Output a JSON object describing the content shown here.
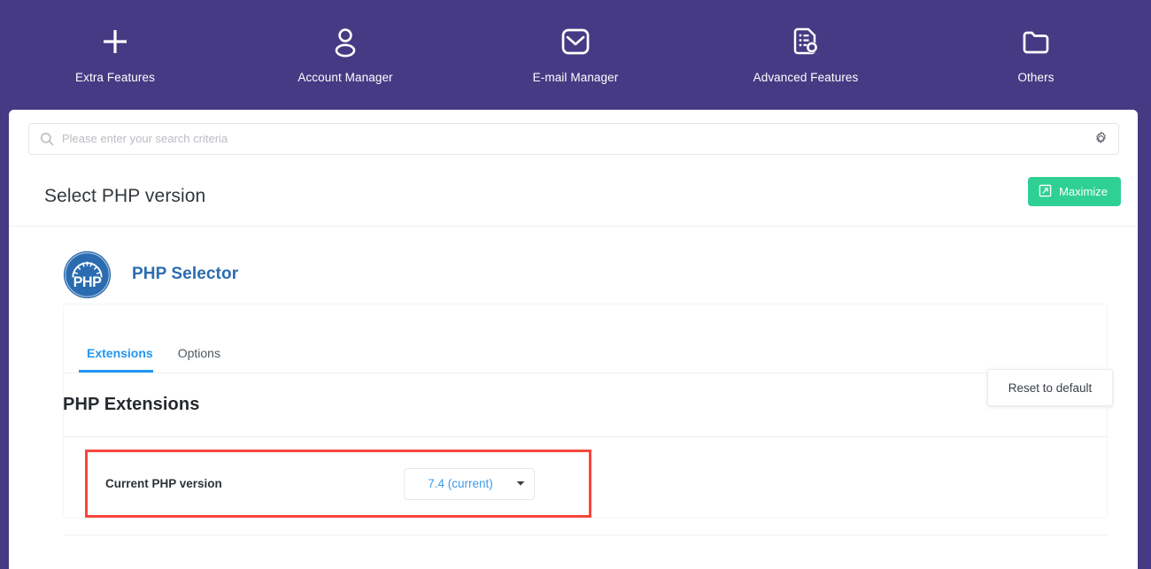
{
  "colors": {
    "nav_background": "#463A84",
    "accent_blue": "#2196f3",
    "brand_blue": "#2b6cb0",
    "maximize_green": "#2fd094",
    "highlight_red": "#f9463c",
    "select_text_blue": "#3d9ae8"
  },
  "top_nav": {
    "items": [
      {
        "label": "Extra Features",
        "icon": "plus-icon"
      },
      {
        "label": "Account Manager",
        "icon": "user-icon"
      },
      {
        "label": "E-mail Manager",
        "icon": "envelope-icon"
      },
      {
        "label": "Advanced Features",
        "icon": "document-gear-icon"
      },
      {
        "label": "Others",
        "icon": "folder-icon"
      }
    ]
  },
  "search": {
    "placeholder": "Please enter your search criteria",
    "value": "",
    "icon": "search-icon",
    "settings_icon": "gear-icon"
  },
  "header": {
    "title": "Select PHP version",
    "maximize_label": "Maximize",
    "maximize_icon": "expand-icon"
  },
  "app": {
    "logo_text": "PHP",
    "name": "PHP Selector",
    "logo_icon": "php-speedometer-logo"
  },
  "tabs": [
    {
      "label": "Extensions",
      "active": true
    },
    {
      "label": "Options",
      "active": false
    }
  ],
  "extensions": {
    "section_title": "PHP Extensions",
    "reset_label": "Reset to default",
    "version_label": "Current PHP version",
    "version_value": "7.4 (current)",
    "caret_icon": "chevron-down-icon"
  }
}
